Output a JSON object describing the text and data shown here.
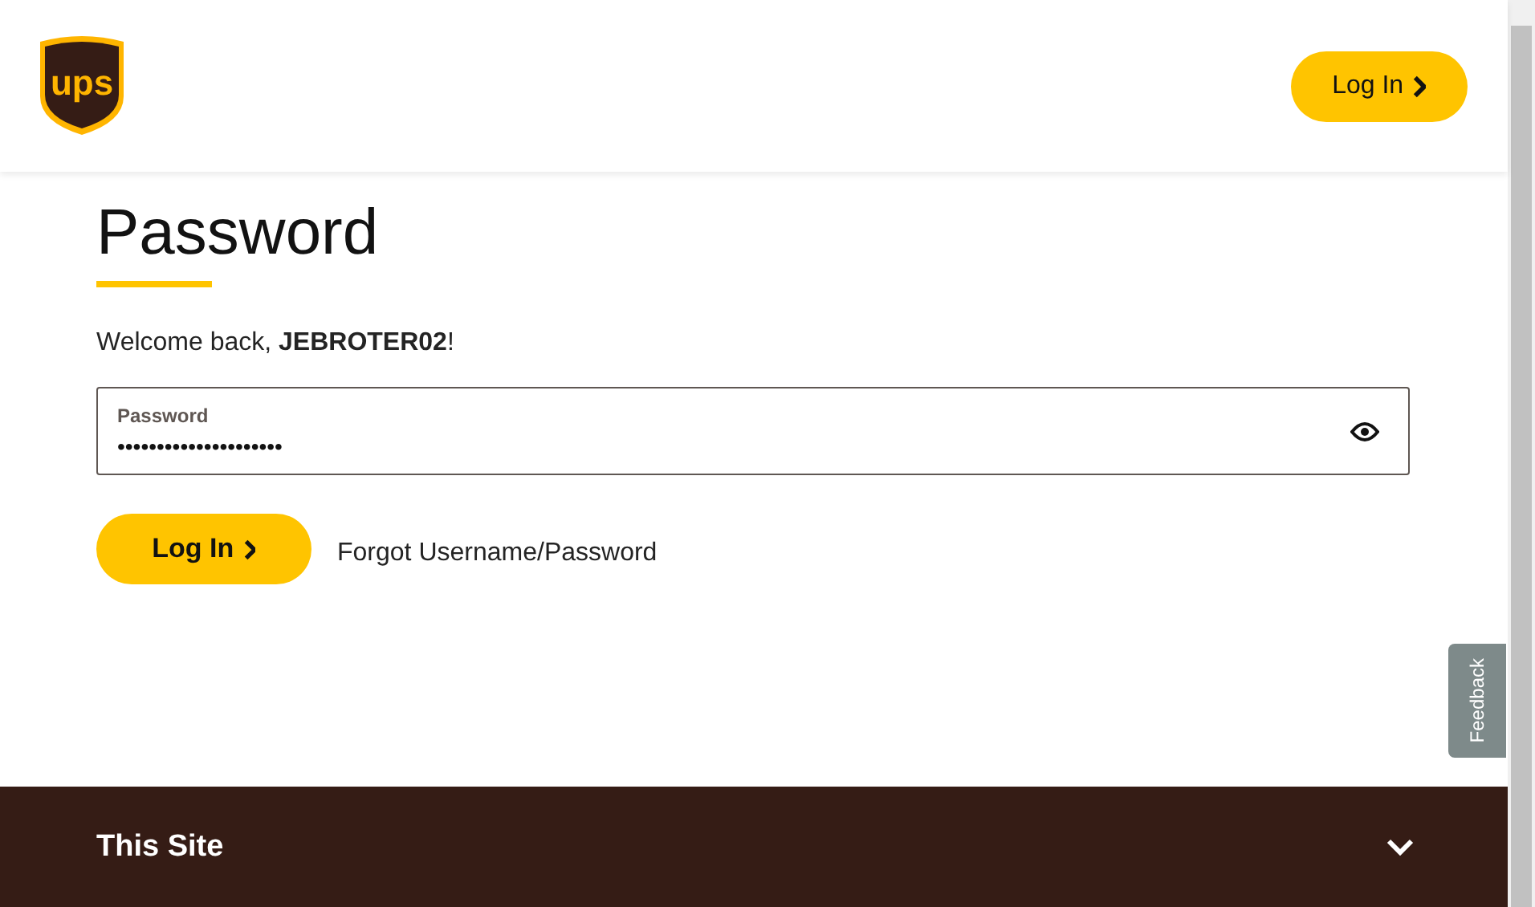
{
  "header": {
    "logo_text": "ups",
    "login_button": "Log In"
  },
  "title": "Password",
  "welcome": "Welcome back, **JEBROTER02**!",
  "password_field": {
    "label": "Password",
    "value": "•••••••••••••••••••••",
    "show_password": false
  },
  "login_button": "Log In",
  "forgot_link": "Forgot Username/Password",
  "feedback_tab": "Feedback",
  "footer": {
    "section_title": "This Site",
    "expanded": false
  }
}
